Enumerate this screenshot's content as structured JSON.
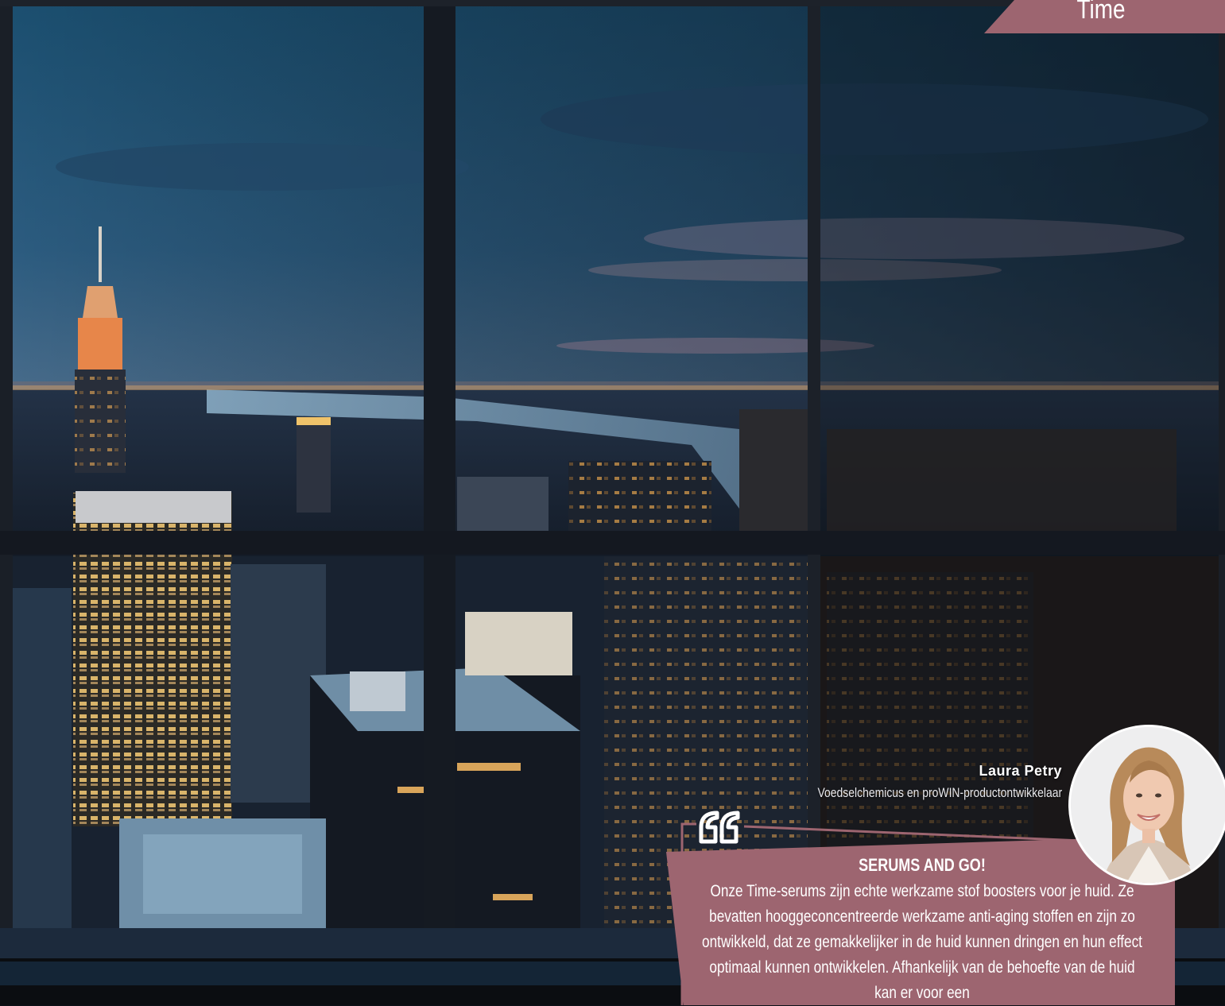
{
  "section_tab": {
    "label": "Time"
  },
  "author": {
    "name": "Laura Petry",
    "role": "Voedselchemicus en proWIN-productontwikkelaar"
  },
  "quote": {
    "title": "SERUMS AND GO!",
    "body": "Onze Time-serums zijn echte werkzame stof boosters voor je huid. Ze bevatten hooggeconcentreerde werkzame anti-aging stoffen en zijn zo ontwikkeld, dat ze gemakkelijker in de huid kunnen dringen en hun effect optimaal kunnen ontwikkelen. Afhankelijk van de behoefte van de huid kan er voor een"
  },
  "colors": {
    "accent": "#9d6570",
    "text_on_accent": "#ffffff"
  },
  "icons": {
    "quote": "quote-icon"
  }
}
